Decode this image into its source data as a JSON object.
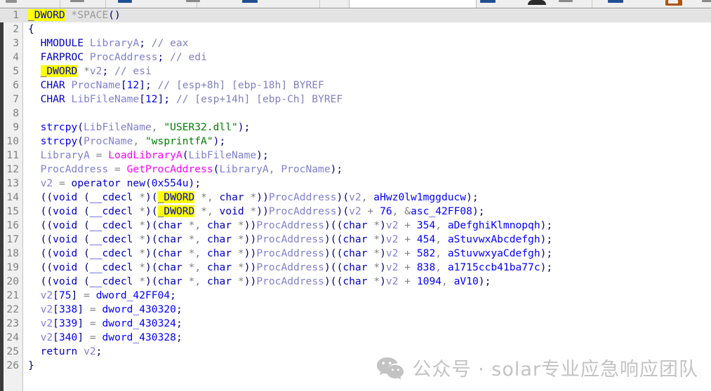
{
  "app": {
    "name": "hex-rays-pseudocode-view",
    "toolbar": {
      "visible_strip": true,
      "separator_count": 6
    }
  },
  "editor": {
    "gutter": {
      "first_line": 1,
      "last_line": 26
    },
    "current_line": 1,
    "highlighted_token": "_DWORD",
    "colors": {
      "background": "#ffffff",
      "gutter_background": "#f0f0f0",
      "current_line_background": "#e3e3e3",
      "keyword": "#0000c0",
      "library_function": "#0000ff",
      "imported_api": "#ff00ff",
      "local_variable": "#8080d0",
      "string": "#008000",
      "comment": "#8080c0",
      "punctuation": "#000080",
      "operator": "#808080",
      "highlight": "#ffff00",
      "line_number": "#808080"
    },
    "lines": [
      {
        "n": "1",
        "text": "_DWORD *SPACE()"
      },
      {
        "n": "2",
        "text": "{"
      },
      {
        "n": "3",
        "text": "  HMODULE LibraryA; // eax"
      },
      {
        "n": "4",
        "text": "  FARPROC ProcAddress; // edi"
      },
      {
        "n": "5",
        "text": "  _DWORD *v2; // esi"
      },
      {
        "n": "6",
        "text": "  CHAR ProcName[12]; // [esp+8h] [ebp-18h] BYREF"
      },
      {
        "n": "7",
        "text": "  CHAR LibFileName[12]; // [esp+14h] [ebp-Ch] BYREF"
      },
      {
        "n": "8",
        "text": ""
      },
      {
        "n": "9",
        "text": "  strcpy(LibFileName, \"USER32.dll\");"
      },
      {
        "n": "10",
        "text": "  strcpy(ProcName, \"wsprintfA\");"
      },
      {
        "n": "11",
        "text": "  LibraryA = LoadLibraryA(LibFileName);"
      },
      {
        "n": "12",
        "text": "  ProcAddress = GetProcAddress(LibraryA, ProcName);"
      },
      {
        "n": "13",
        "text": "  v2 = operator new(0x554u);"
      },
      {
        "n": "14",
        "text": "  ((void (__cdecl *)(_DWORD *, char *))ProcAddress)(v2, aHwz0lw1mggducw);"
      },
      {
        "n": "15",
        "text": "  ((void (__cdecl *)(_DWORD *, void *))ProcAddress)(v2 + 76, &asc_42FF08);"
      },
      {
        "n": "16",
        "text": "  ((void (__cdecl *)(char *, char *))ProcAddress)((char *)v2 + 354, aDefghiKlmnopqh);"
      },
      {
        "n": "17",
        "text": "  ((void (__cdecl *)(char *, char *))ProcAddress)((char *)v2 + 454, aStuvwxAbcdefgh);"
      },
      {
        "n": "18",
        "text": "  ((void (__cdecl *)(char *, char *))ProcAddress)((char *)v2 + 582, aStuvwxyaCdefgh);"
      },
      {
        "n": "19",
        "text": "  ((void (__cdecl *)(char *, char *))ProcAddress)((char *)v2 + 838, a1715ccb41ba77c);"
      },
      {
        "n": "20",
        "text": "  ((void (__cdecl *)(char *, char *))ProcAddress)((char *)v2 + 1094, aV10);"
      },
      {
        "n": "21",
        "text": "  v2[75] = dword_42FF04;"
      },
      {
        "n": "22",
        "text": "  v2[338] = dword_430320;"
      },
      {
        "n": "23",
        "text": "  v2[339] = dword_430324;"
      },
      {
        "n": "24",
        "text": "  v2[340] = dword_430328;"
      },
      {
        "n": "25",
        "text": "  return v2;"
      },
      {
        "n": "26",
        "text": "}"
      }
    ],
    "function_name": "SPACE",
    "return_type": "_DWORD *",
    "identifiers": {
      "locals": [
        "LibraryA",
        "ProcAddress",
        "v2",
        "ProcName",
        "LibFileName"
      ],
      "apis": [
        "LoadLibraryA",
        "GetProcAddress"
      ],
      "library_functions": [
        "strcpy",
        "operator new"
      ],
      "strings": [
        "USER32.dll",
        "wsprintfA"
      ],
      "data_refs": [
        "aHwz0lw1mggducw",
        "asc_42FF08",
        "aDefghiKlmnopqh",
        "aStuvwxAbcdefgh",
        "aStuvwxyaCdefgh",
        "a1715ccb41ba77c",
        "aV10",
        "dword_42FF04",
        "dword_430320",
        "dword_430324",
        "dword_430328"
      ]
    }
  },
  "watermark": {
    "icon": "wechat-icon",
    "text": "公众号 · solar专业应急响应团队",
    "color": "#c3c3c3"
  }
}
